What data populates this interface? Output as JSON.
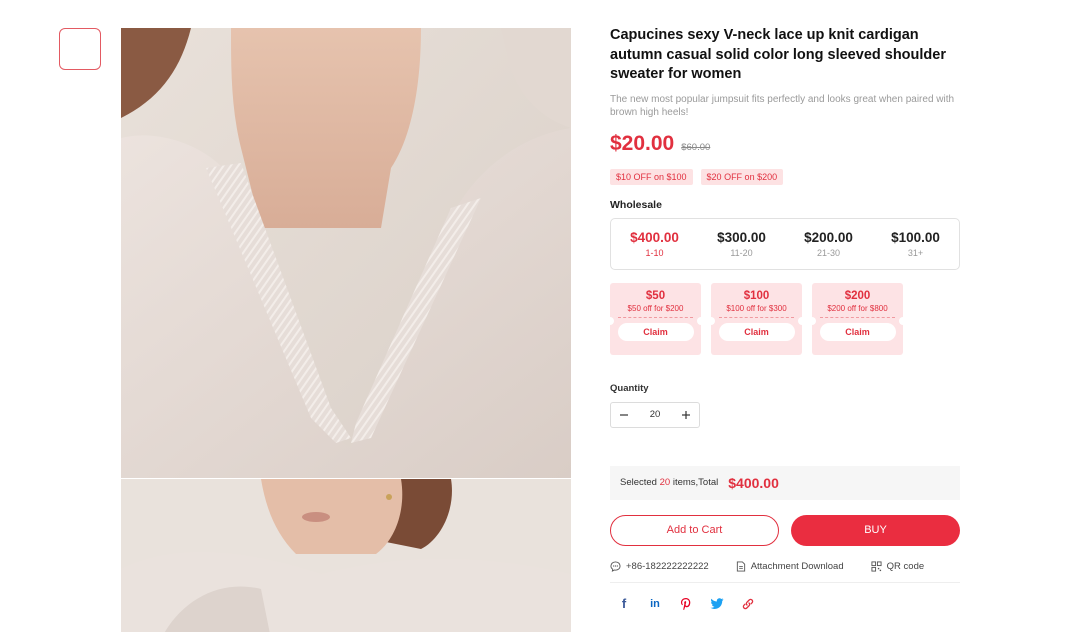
{
  "product": {
    "title": "Capucines sexy V-neck lace up knit cardigan autumn casual solid color long sleeved shoulder sweater for women",
    "subtitle": "The new most popular jumpsuit fits perfectly and looks great when paired with brown high heels!",
    "price": "$20.00",
    "original_price": "$60.00",
    "promo_tags": [
      "$10 OFF on $100",
      "$20 OFF on $200"
    ]
  },
  "wholesale": {
    "label": "Wholesale",
    "tiers": [
      {
        "price": "$400.00",
        "range": "1-10",
        "active": true
      },
      {
        "price": "$300.00",
        "range": "11-20",
        "active": false
      },
      {
        "price": "$200.00",
        "range": "21-30",
        "active": false
      },
      {
        "price": "$100.00",
        "range": "31+",
        "active": false
      }
    ]
  },
  "coupons": [
    {
      "amount": "$50",
      "desc": "$50 off for $200",
      "button": "Claim"
    },
    {
      "amount": "$100",
      "desc": "$100 off for $300",
      "button": "Claim"
    },
    {
      "amount": "$200",
      "desc": "$200 off for $800",
      "button": "Claim"
    }
  ],
  "quantity": {
    "label": "Quantity",
    "value": "20",
    "minus_icon": "minus-icon",
    "plus_icon": "plus-icon"
  },
  "summary": {
    "prefix": "Selected ",
    "count": "20",
    "suffix": " items,Total",
    "total": "$400.00"
  },
  "actions": {
    "add_to_cart": "Add to Cart",
    "buy": "BUY"
  },
  "meta": {
    "phone": "+86-182222222222",
    "attachment": "Attachment Download",
    "qr": "QR code"
  },
  "share": [
    {
      "name": "facebook-icon",
      "glyph": "f",
      "color": "#3b5998"
    },
    {
      "name": "linkedin-icon",
      "glyph": "in",
      "color": "#0a66c2"
    },
    {
      "name": "pinterest-icon",
      "glyph": "P",
      "color": "#e60023"
    },
    {
      "name": "twitter-icon",
      "glyph": "t",
      "color": "#1da1f2"
    },
    {
      "name": "link-icon",
      "glyph": "",
      "color": "#e1303f"
    }
  ],
  "colors": {
    "accent": "#e1303f",
    "coupon_bg": "#fde3e5",
    "tag_bg": "#fde2e3"
  }
}
